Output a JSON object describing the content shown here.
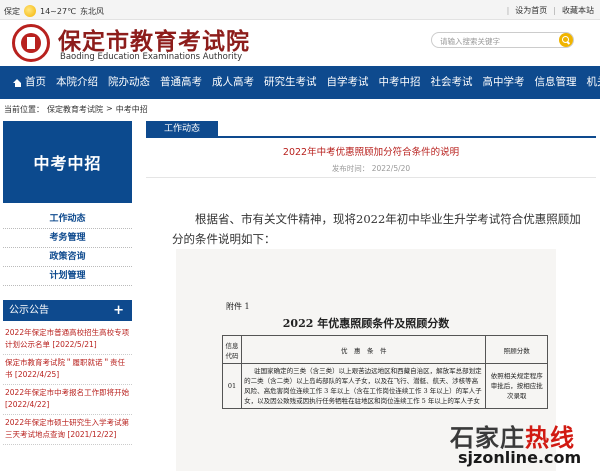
{
  "topbar": {
    "city": "保定",
    "weather_icon": "sun-icon",
    "temperature": "14~27℃",
    "wind": "东北风",
    "set_homepage": "设为首页",
    "separator": "|",
    "bookmark": "收藏本站"
  },
  "header": {
    "site_name": "保定市教育考试院",
    "site_name_en": "Baoding Education Examinations Authority",
    "search_placeholder": "请输入搜索关键字"
  },
  "nav": {
    "items": [
      "首页",
      "本院介绍",
      "院办动态",
      "普通高考",
      "成人高考",
      "研究生考试",
      "自学考试",
      "中考中招",
      "社会考试",
      "高中学考",
      "信息管理",
      "机关党委"
    ]
  },
  "breadcrumb": {
    "label": "当前位置：",
    "home": "保定教育考试院",
    "sep": ">",
    "current": "中考中招"
  },
  "sidebar": {
    "banner": "中考中招",
    "menu": [
      "工作动态",
      "考务管理",
      "政策咨询",
      "计划管理"
    ],
    "notice_title": "公示公告",
    "notice_plus": "+",
    "notices": [
      {
        "text": "2022年保定市普通高校招生高校专项计划公示名单",
        "date": "[2022/5/21]"
      },
      {
        "text": "保定市教育考试院＂履职就诺＂责任书",
        "date": "[2022/4/25]"
      },
      {
        "text": "2022年保定市中考报名工作即将开始",
        "date": "[2022/4/22]"
      },
      {
        "text": "2022年保定市硕士研究生入学考试第三天考试地点查询",
        "date": "[2021/12/22]"
      }
    ]
  },
  "article": {
    "tab": "工作动态",
    "title": "2022年中考优惠照顾加分符合条件的说明",
    "meta_label": "发布时间：",
    "meta_date": "2022/5/20",
    "body": "根据省、市有关文件精神，现将2022年初中毕业生升学考试符合优惠照顾加分的条件说明如下："
  },
  "document": {
    "attachment": "附件 1",
    "title": "2022 年优惠照顾条件及照顾分数",
    "headers": [
      "信息代码",
      "优　惠　条　件",
      "照顾分数"
    ],
    "row": {
      "code": "01",
      "condition": "驻国家确定的三类（含三类）以上艰苦边远地区和西藏自治区，解放军总部划定的二类（含二类）以上岛屿部队的军人子女，以及在飞行、潜艇、航天、涉核等高风险、高危害岗位连续工作 3 年以上（含在工作岗位连续工作 3 年以上）的军人子女，以及因公致残或因执行任务牺牲在驻地区和岗位连续工作 5 年以上的军人子女",
      "way": "依照相关规定程序审批后，按相应批次录取"
    }
  },
  "watermark": {
    "main_a": "石家庄",
    "main_b": "热线",
    "sub": "sjzonline.com"
  }
}
